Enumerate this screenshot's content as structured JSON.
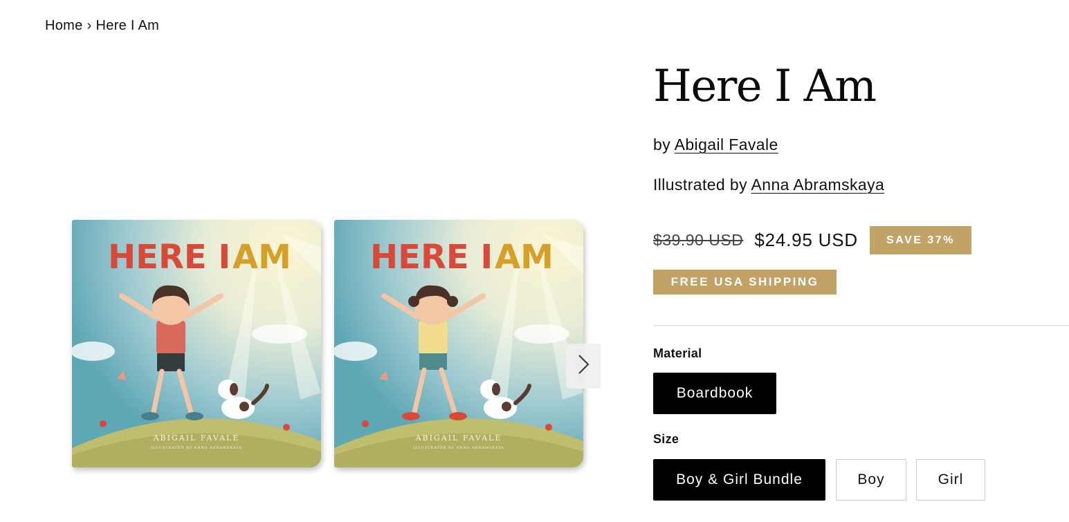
{
  "breadcrumb": {
    "home": "Home",
    "separator": "›",
    "current": "Here I Am"
  },
  "product": {
    "title": "Here I Am",
    "by_prefix": "by",
    "author": "Abigail Favale",
    "illustrated_prefix": "Illustrated by",
    "illustrator": "Anna Abramskaya",
    "compare_price": "$39.90 USD",
    "price": "$24.95 USD",
    "save_badge": "SAVE 37%",
    "shipping_badge": "FREE USA SHIPPING"
  },
  "gallery": {
    "images": [
      {
        "cover_title_part1": "HERE I",
        "cover_title_part2": "AM",
        "author": "ABIGAIL FAVALE",
        "illustrator_line": "ILLUSTRATED BY ANNA ABRAMSKAYA",
        "variant": "boy"
      },
      {
        "cover_title_part1": "HERE I",
        "cover_title_part2": "AM",
        "author": "ABIGAIL FAVALE",
        "illustrator_line": "ILLUSTRATED BY ANNA ABRAMSKAYA",
        "variant": "girl"
      }
    ],
    "next_icon": "chevron-right-icon"
  },
  "options": {
    "material": {
      "label": "Material",
      "values": [
        "Boardbook"
      ],
      "selected": "Boardbook"
    },
    "size": {
      "label": "Size",
      "values": [
        "Boy & Girl Bundle",
        "Boy",
        "Girl"
      ],
      "selected": "Boy & Girl Bundle"
    }
  },
  "colors": {
    "accent_gold": "#c1a267",
    "cover_red": "#d9493a",
    "cover_mustard": "#d4a02a",
    "selected_bg": "#000000"
  }
}
